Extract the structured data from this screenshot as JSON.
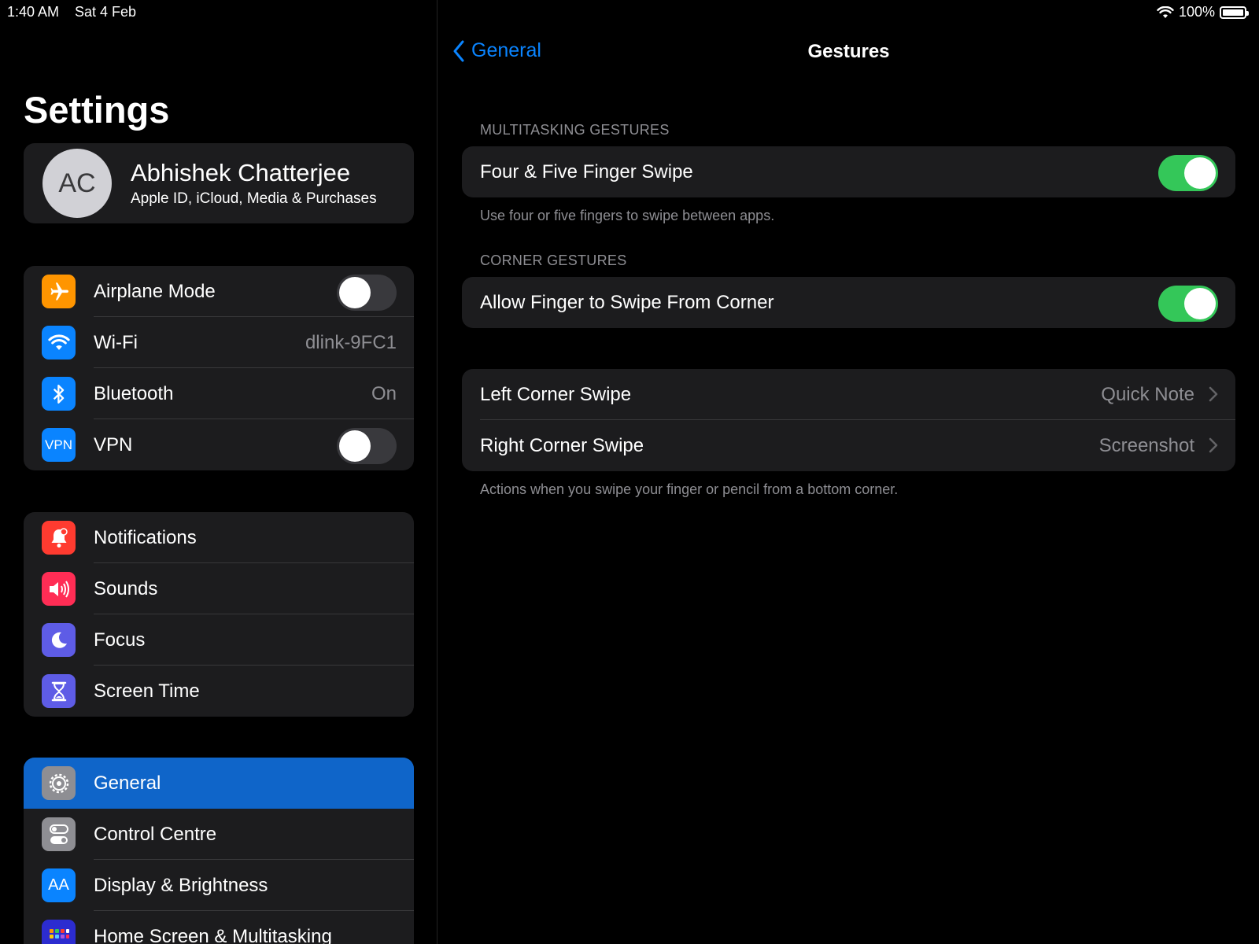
{
  "status": {
    "time": "1:40 AM",
    "date": "Sat 4 Feb",
    "battery": "100%"
  },
  "sidebar": {
    "title": "Settings",
    "profile": {
      "initials": "AC",
      "name": "Abhishek Chatterjee",
      "subtitle": "Apple ID, iCloud, Media & Purchases"
    },
    "groups": [
      [
        {
          "label": "Airplane Mode",
          "icon": "airplane-icon",
          "color": "#ff9500",
          "toggle": false
        },
        {
          "label": "Wi-Fi",
          "icon": "wifi-icon",
          "color": "#0a84ff",
          "value": "dlink-9FC1"
        },
        {
          "label": "Bluetooth",
          "icon": "bluetooth-icon",
          "color": "#0a84ff",
          "value": "On"
        },
        {
          "label": "VPN",
          "icon": "vpn-icon",
          "icon_text": "VPN",
          "color": "#0a84ff",
          "toggle": false
        }
      ],
      [
        {
          "label": "Notifications",
          "icon": "bell-icon",
          "color": "#ff3b30"
        },
        {
          "label": "Sounds",
          "icon": "speaker-icon",
          "color": "#ff2d55"
        },
        {
          "label": "Focus",
          "icon": "moon-icon",
          "color": "#5e5ce6"
        },
        {
          "label": "Screen Time",
          "icon": "hourglass-icon",
          "color": "#5e5ce6"
        }
      ],
      [
        {
          "label": "General",
          "icon": "gear-icon",
          "color": "#8e8e93",
          "selected": true
        },
        {
          "label": "Control Centre",
          "icon": "switches-icon",
          "color": "#8e8e93"
        },
        {
          "label": "Display & Brightness",
          "icon": "text-size-icon",
          "icon_text": "AA",
          "color": "#0a84ff"
        },
        {
          "label": "Home Screen & Multitasking",
          "icon": "grid-icon",
          "color": "#2c2cd0"
        }
      ]
    ]
  },
  "detail": {
    "back_label": "General",
    "title": "Gestures",
    "multitasking_header": "MULTITASKING GESTURES",
    "four_five_label": "Four & Five Finger Swipe",
    "four_five_on": true,
    "multitasking_footer": "Use four or five fingers to swipe between apps.",
    "corner_header": "CORNER GESTURES",
    "allow_corner_label": "Allow Finger to Swipe From Corner",
    "allow_corner_on": true,
    "left_corner_label": "Left Corner Swipe",
    "left_corner_value": "Quick Note",
    "right_corner_label": "Right Corner Swipe",
    "right_corner_value": "Screenshot",
    "corner_footer": "Actions when you swipe your finger or pencil from a bottom corner."
  },
  "colors": {
    "accent": "#0a84ff",
    "toggle_on": "#34c759",
    "selected_row": "#0f65c9",
    "cell_bg": "#1c1c1e"
  }
}
